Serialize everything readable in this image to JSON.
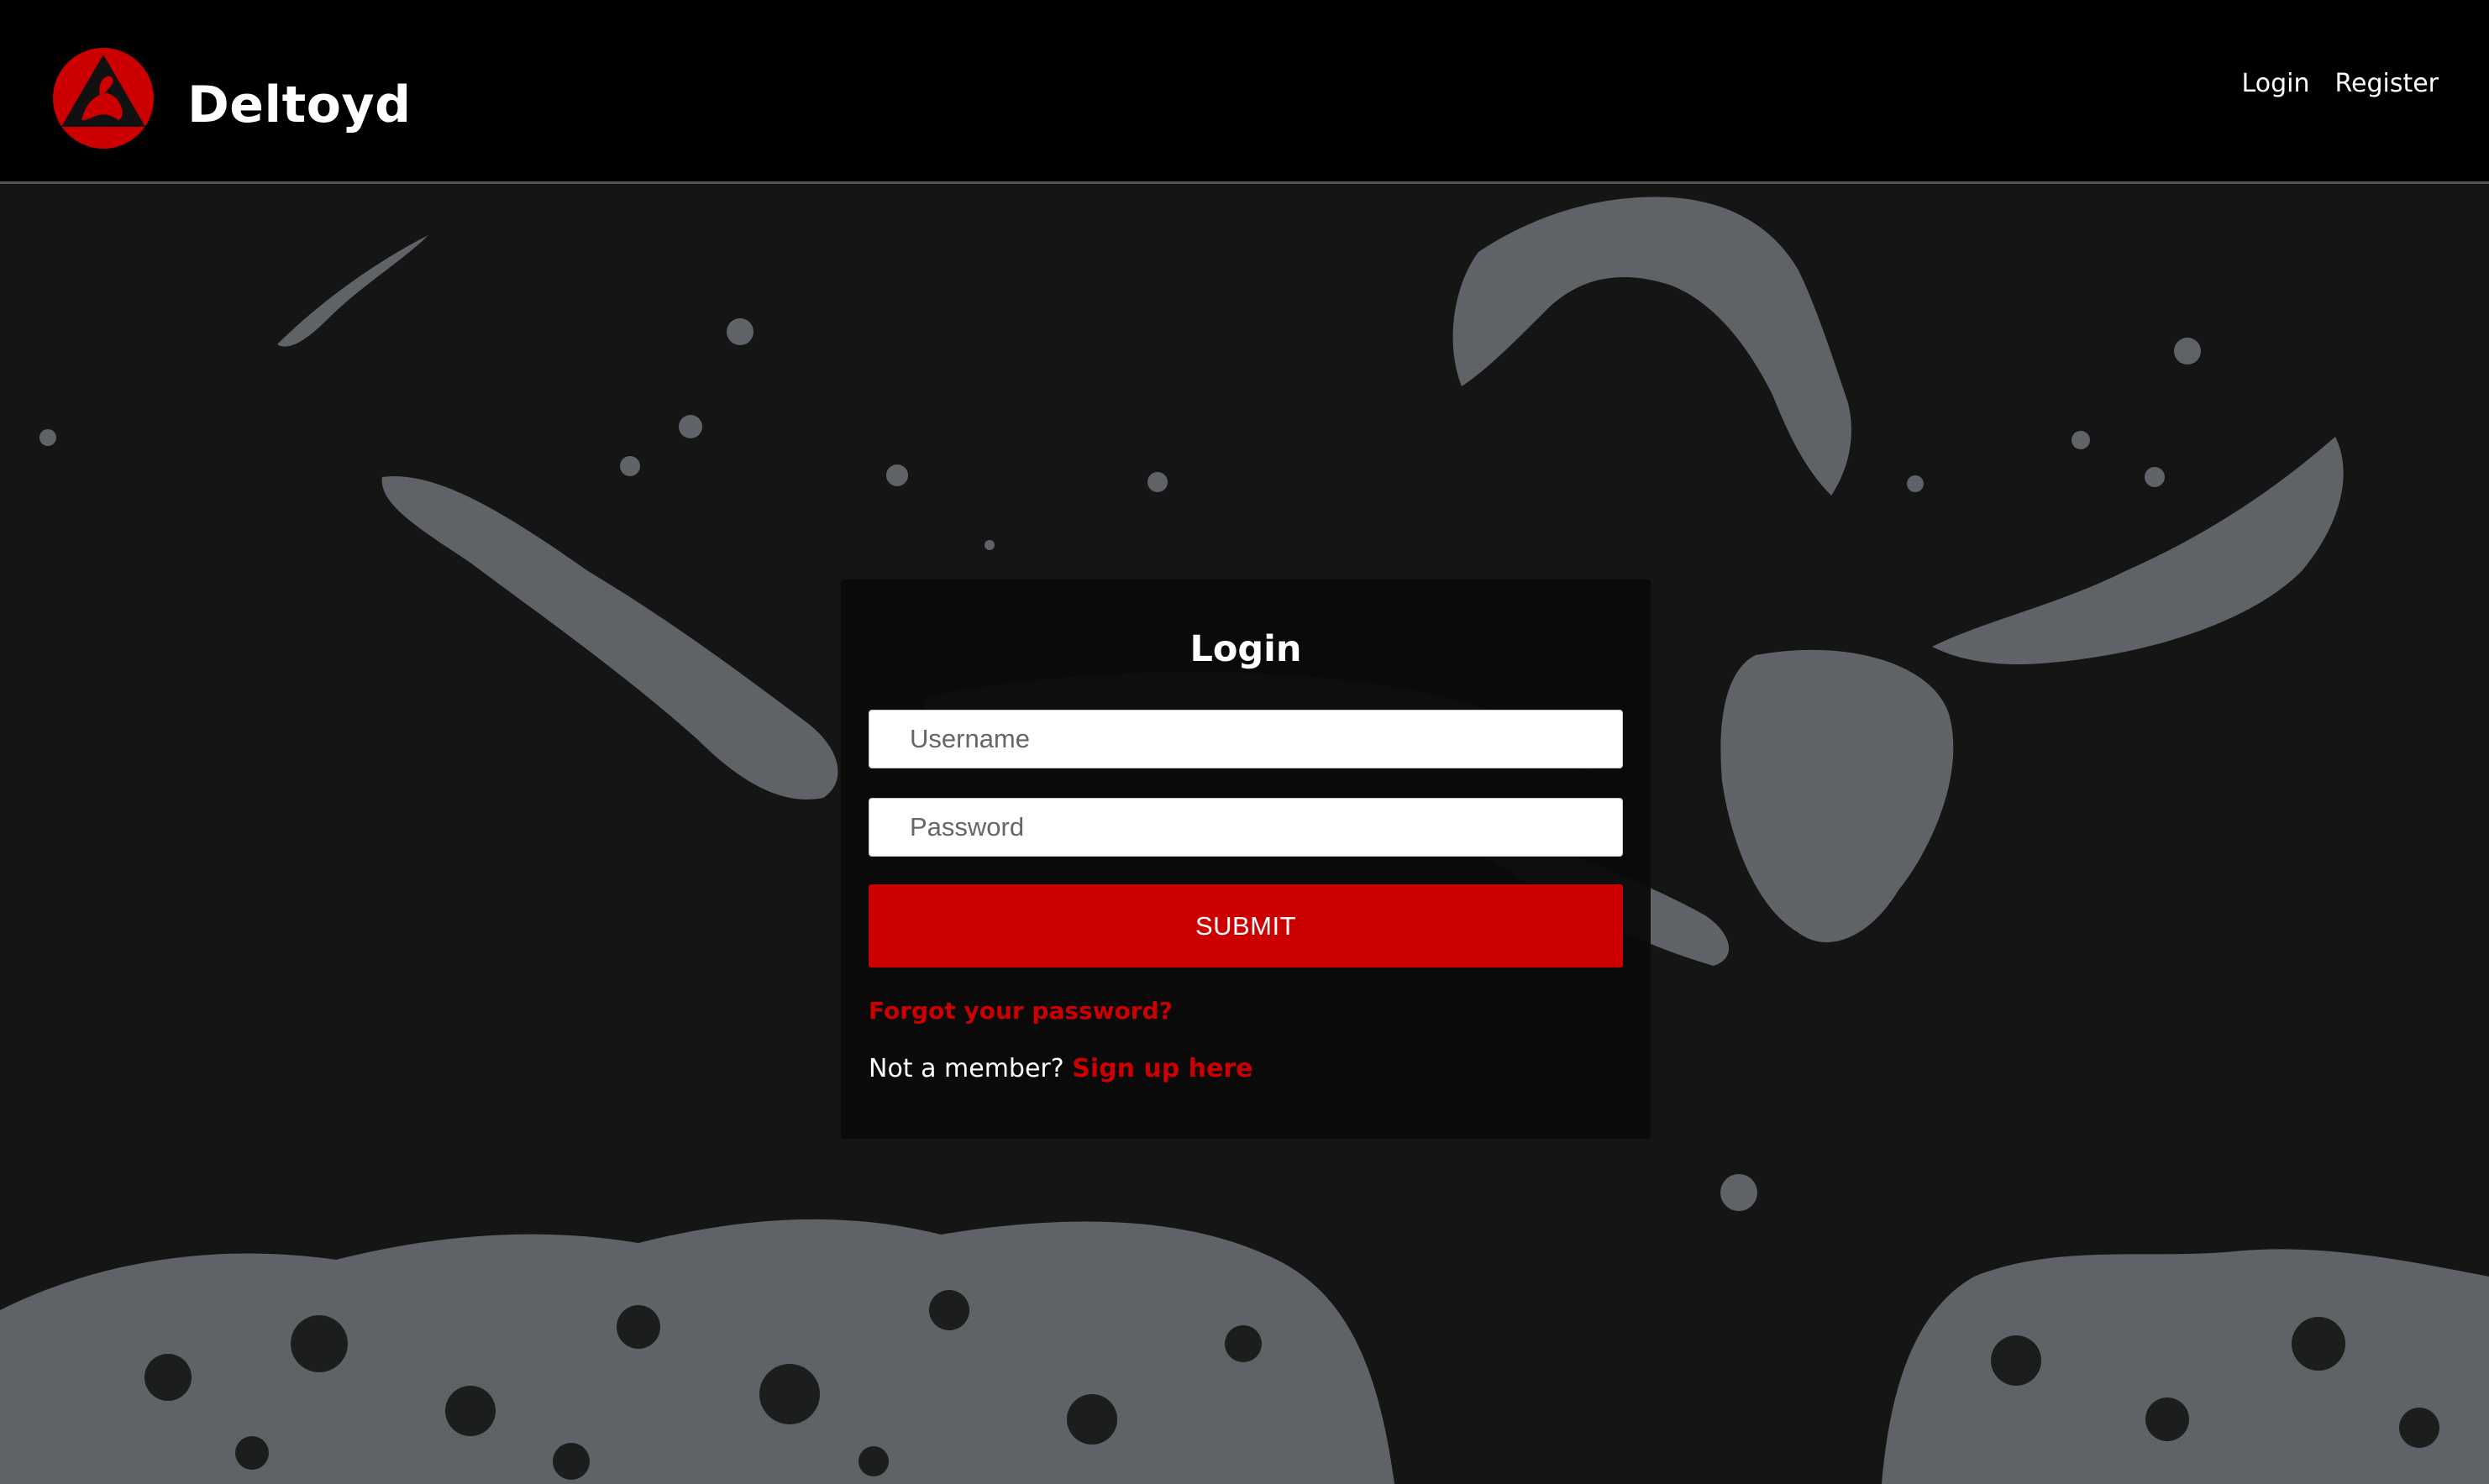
{
  "brand": {
    "name": "Deltoyd",
    "logo_icon": "flexed-arm-triangle-logo-icon",
    "accent": "#cc0000"
  },
  "nav": {
    "login_label": "Login",
    "register_label": "Register"
  },
  "login": {
    "title": "Login",
    "username_placeholder": "Username",
    "password_placeholder": "Password",
    "submit_label": "SUBMIT",
    "forgot_label": "Forgot your password?",
    "not_member_text": "Not a member?",
    "signup_label": "Sign up here"
  },
  "colors": {
    "page_bg": "#151515",
    "navbar_bg": "#000000",
    "splash": "#8a8f95",
    "accent": "#cc0000"
  }
}
